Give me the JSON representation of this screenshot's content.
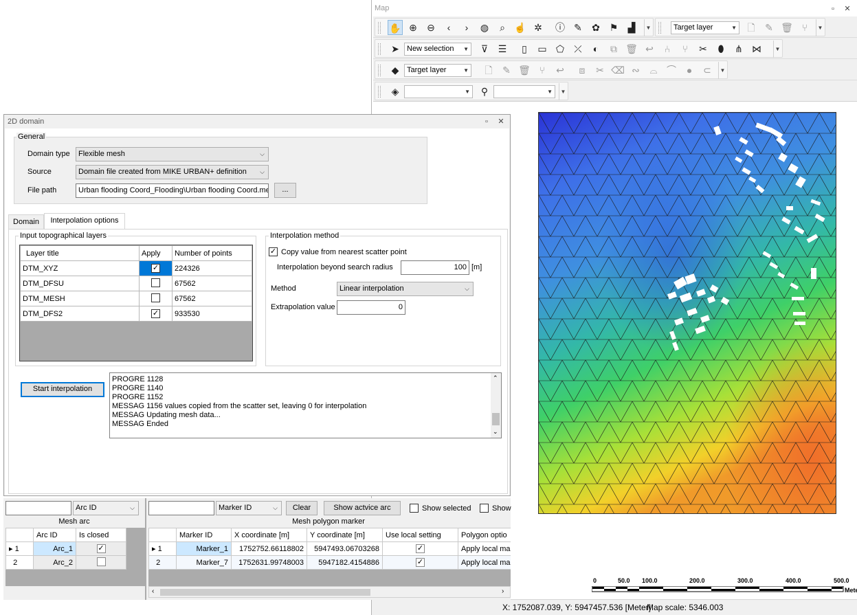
{
  "map": {
    "title": "Map",
    "toolbar1": {
      "target_layer": "Target layer"
    },
    "toolbar2": {
      "selection": "New selection"
    },
    "toolbar3": {
      "target_layer": "Target layer"
    },
    "toolbar4": {
      "layer_combo": "",
      "search_combo": ""
    },
    "scale": {
      "ticks": [
        "0",
        "50.0",
        "100.0",
        "200.0",
        "300.0",
        "400.0",
        "500.0"
      ],
      "unit": "Mete"
    },
    "status": {
      "coords": "X: 1752087.039, Y: 5947457.536 [Meter]",
      "scale": "Map scale: 5346.003"
    }
  },
  "domain": {
    "title": "2D domain",
    "general": {
      "title": "General",
      "domain_type_label": "Domain type",
      "domain_type": "Flexible mesh",
      "source_label": "Source",
      "source": "Domain file created from MIKE URBAN+ definition",
      "file_path_label": "File path",
      "file_path": "Urban flooding Coord_Flooding\\Urban flooding Coord.mesh",
      "browse": "..."
    },
    "tabs": [
      "Domain",
      "Interpolation options"
    ],
    "layers": {
      "title": "Input topographical layers",
      "headers": [
        "Layer title",
        "Apply",
        "Number of points"
      ],
      "rows": [
        {
          "title": "DTM_XYZ",
          "apply": "✓",
          "points": "224326"
        },
        {
          "title": "DTM_DFSU",
          "apply": "",
          "points": "67562"
        },
        {
          "title": "DTM_MESH",
          "apply": "",
          "points": "67562"
        },
        {
          "title": "DTM_DFS2",
          "apply": "✓",
          "points": "933530"
        }
      ]
    },
    "method": {
      "title": "Interpolation method",
      "copy_label": "Copy value from nearest scatter point",
      "beyond_label": "Interpolation beyond search radius",
      "beyond_value": "100",
      "beyond_unit": "[m]",
      "method_label": "Method",
      "method_value": "Linear interpolation",
      "extrap_label": "Extrapolation value",
      "extrap_value": "0"
    },
    "start_button": "Start interpolation",
    "log": [
      "PROGRE 1128",
      "PROGRE 1140",
      "PROGRE 1152",
      "MESSAG 1156 values copied from the scatter set, leaving 0 for interpolation",
      "MESSAG Updating mesh data...",
      "MESSAG Ended"
    ]
  },
  "mesh_arc": {
    "title": "Mesh arc",
    "filter_combo": "Arc ID",
    "headers": [
      "Arc ID",
      "Is closed"
    ],
    "rows": [
      {
        "num": "1",
        "id": "Arc_1",
        "closed": "✓"
      },
      {
        "num": "2",
        "id": "Arc_2",
        "closed": ""
      }
    ]
  },
  "marker": {
    "title": "Mesh polygon marker",
    "filter_combo": "Marker ID",
    "clear": "Clear",
    "show_active": "Show actvice arc",
    "show_selected": "Show selected",
    "show_cut": "Show",
    "headers": [
      "Marker ID",
      "X coordinate [m]",
      "Y coordinate [m]",
      "Use local setting",
      "Polygon optio"
    ],
    "rows": [
      {
        "num": "1",
        "id": "Marker_1",
        "x": "1752752.66118802",
        "y": "5947493.06703268",
        "local": "✓",
        "opt": "Apply local ma"
      },
      {
        "num": "2",
        "id": "Marker_7",
        "x": "1752631.99748003",
        "y": "5947182.4154886",
        "local": "✓",
        "opt": "Apply local ma"
      }
    ]
  },
  "colors": {
    "selected_cell": "#cce8ff",
    "check_blue": "#0078d7"
  }
}
